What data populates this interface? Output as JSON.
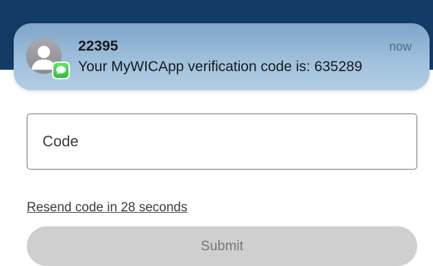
{
  "notification": {
    "sender": "22395",
    "message": "Your MyWICApp verification code is: 635289",
    "time": "now",
    "app_icon": "messages-icon",
    "avatar_icon": "person-icon"
  },
  "form": {
    "code_placeholder": "Code",
    "code_value": "",
    "resend_label": "Resend code in 28 seconds",
    "submit_label": "Submit"
  },
  "colors": {
    "header": "#123b66",
    "notification_bg": "#9fc0dc",
    "messages_badge": "#34c759",
    "submit_disabled_bg": "#cfcfcf",
    "submit_disabled_text": "#777777"
  }
}
